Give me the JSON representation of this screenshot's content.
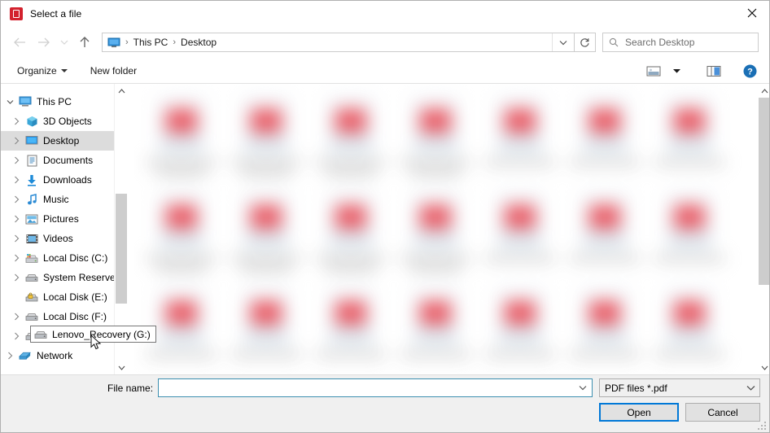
{
  "window": {
    "title": "Select a file",
    "app_icon": "pdf-app-icon",
    "close_label": "✕",
    "accent_color": "#0078d7",
    "pdf_icon_color": "#d3212d"
  },
  "nav": {
    "back_icon": "back-arrow-icon",
    "forward_icon": "forward-arrow-icon",
    "recent_icon": "recent-locations-chevron-icon",
    "up_icon": "up-arrow-icon",
    "refresh_icon": "refresh-icon",
    "breadcrumb_dropdown_icon": "chevron-down-icon",
    "breadcrumb": [
      {
        "label": "This PC"
      },
      {
        "label": "Desktop"
      }
    ],
    "breadcrumb_separator": "›"
  },
  "search": {
    "icon": "search-icon",
    "placeholder": "Search Desktop",
    "value": ""
  },
  "toolbar": {
    "organize_label": "Organize",
    "new_folder_label": "New folder",
    "view_icon": "view-layout-icon",
    "view_caret_icon": "chevron-down-icon",
    "preview_pane_icon": "preview-pane-icon",
    "help_icon": "help-icon"
  },
  "sidebar": {
    "items": [
      {
        "label": "This PC",
        "icon": "this-pc-icon",
        "expander": "chevron-down",
        "indent": 0,
        "selected": false
      },
      {
        "label": "3D Objects",
        "icon": "3d-objects-icon",
        "expander": "chevron-right",
        "indent": 1,
        "selected": false
      },
      {
        "label": "Desktop",
        "icon": "desktop-icon",
        "expander": "chevron-right",
        "indent": 1,
        "selected": true
      },
      {
        "label": "Documents",
        "icon": "documents-icon",
        "expander": "chevron-right",
        "indent": 1,
        "selected": false
      },
      {
        "label": "Downloads",
        "icon": "downloads-icon",
        "expander": "chevron-right",
        "indent": 1,
        "selected": false
      },
      {
        "label": "Music",
        "icon": "music-icon",
        "expander": "chevron-right",
        "indent": 1,
        "selected": false
      },
      {
        "label": "Pictures",
        "icon": "pictures-icon",
        "expander": "chevron-right",
        "indent": 1,
        "selected": false
      },
      {
        "label": "Videos",
        "icon": "videos-icon",
        "expander": "chevron-right",
        "indent": 1,
        "selected": false
      },
      {
        "label": "Local Disc (C:)",
        "icon": "windows-drive-icon",
        "expander": "chevron-right",
        "indent": 1,
        "selected": false
      },
      {
        "label": "System Reserved",
        "icon": "drive-icon",
        "expander": "chevron-right",
        "indent": 1,
        "selected": false
      },
      {
        "label": "Local Disk (E:)",
        "icon": "locked-drive-icon",
        "expander": "none",
        "indent": 1,
        "selected": false
      },
      {
        "label": "Local Disc (F:)",
        "icon": "drive-icon",
        "expander": "chevron-right",
        "indent": 1,
        "selected": false
      },
      {
        "label": "Lenovo_Recovery (G:)",
        "icon": "drive-icon",
        "expander": "chevron-right",
        "indent": 1,
        "selected": false
      },
      {
        "label": "Network",
        "icon": "network-icon",
        "expander": "chevron-right",
        "indent": 0,
        "selected": false
      }
    ],
    "scroll_up_icon": "chevron-up-icon",
    "scroll_down_icon": "chevron-down-icon"
  },
  "tooltip": {
    "text": "Lenovo_Recovery (G:)",
    "icon": "drive-icon"
  },
  "cursor": {
    "icon": "mouse-pointer-icon"
  },
  "file_list": {
    "view_mode": "large-icons",
    "content_state": "blurred",
    "columns": 7,
    "rows": 3,
    "item_icon": "pdf-file-icon",
    "scroll_up_icon": "chevron-up-icon",
    "scroll_down_icon": "chevron-down-icon"
  },
  "footer": {
    "filename_label": "File name:",
    "filename_value": "",
    "filename_placeholder": "",
    "filename_dropdown_icon": "chevron-down-icon",
    "filetype_value": "PDF files *.pdf",
    "filetype_caret_icon": "chevron-down-icon",
    "open_label": "Open",
    "cancel_label": "Cancel",
    "resize_grip_icon": "resize-grip-icon"
  }
}
